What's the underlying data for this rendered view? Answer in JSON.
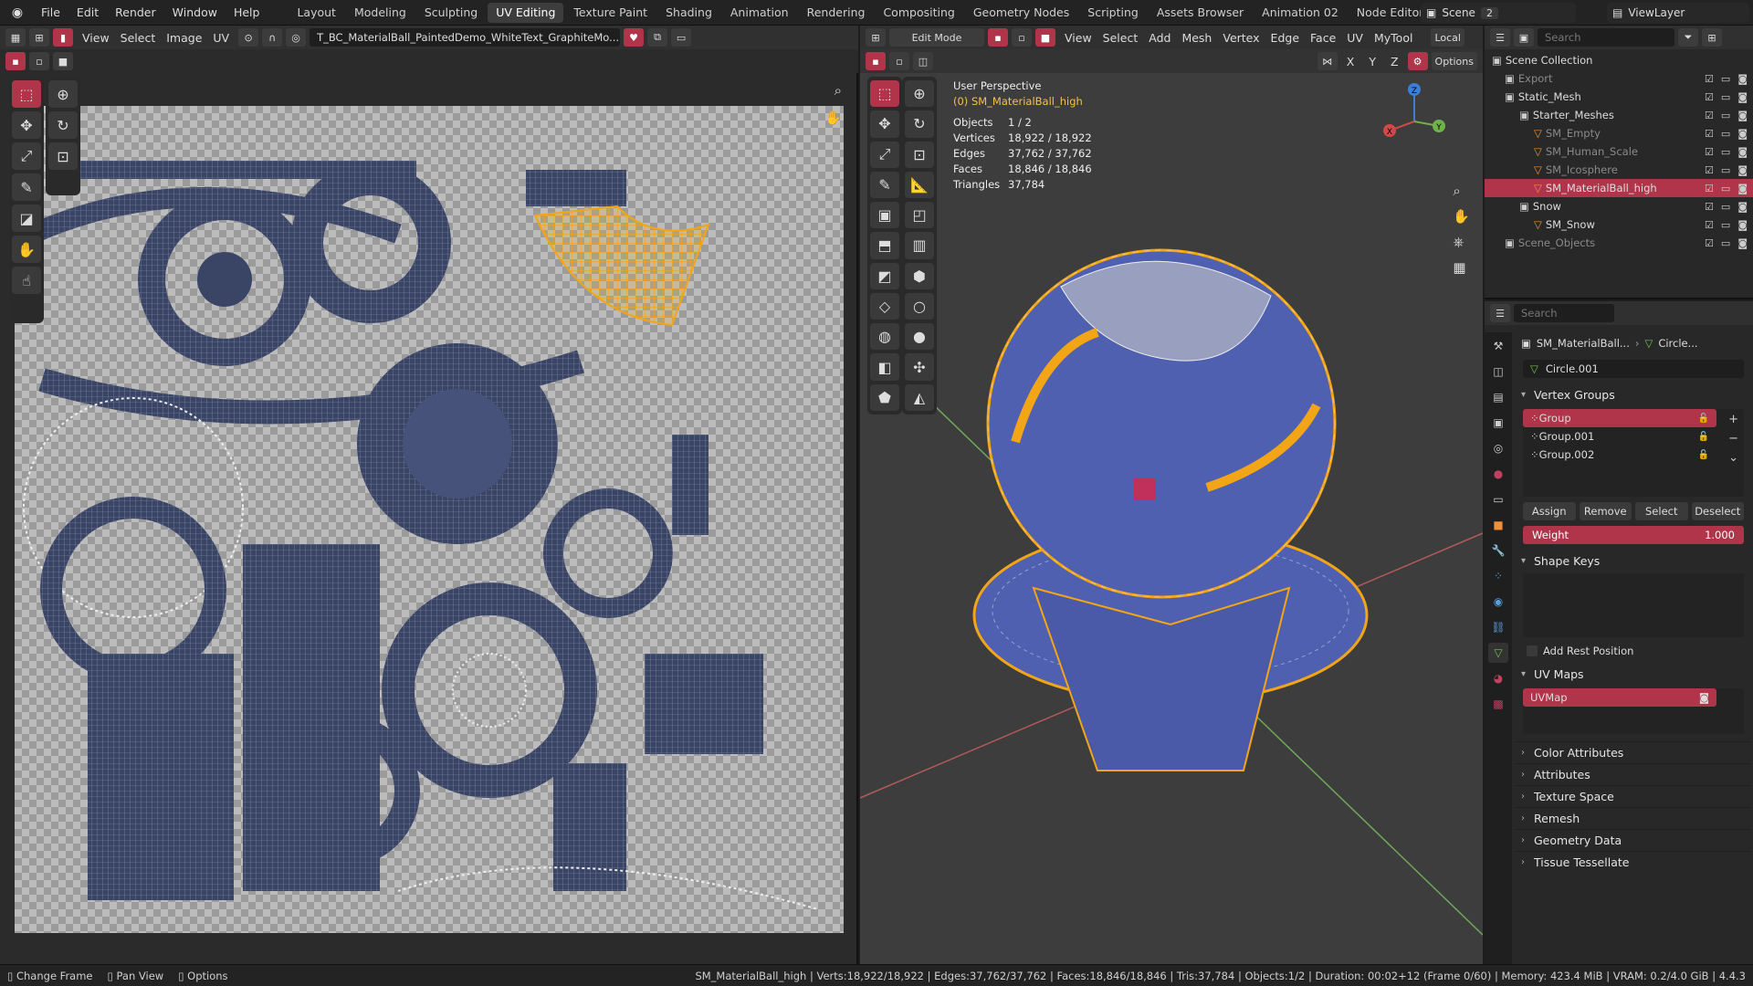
{
  "topbar": {
    "menus": [
      "File",
      "Edit",
      "Render",
      "Window",
      "Help"
    ],
    "workspaces": [
      "Layout",
      "Modeling",
      "Sculpting",
      "UV Editing",
      "Texture Paint",
      "Shading",
      "Animation",
      "Rendering",
      "Compositing",
      "Geometry Nodes",
      "Scripting",
      "Assets Browser",
      "Animation 02",
      "Node Editors"
    ],
    "active_workspace": "UV Editing",
    "add_tab": "+",
    "scene_label": "Scene",
    "scene_users": "2",
    "view_layer": "ViewLayer"
  },
  "uv_editor": {
    "menus": [
      "View",
      "Select",
      "Image",
      "UV"
    ],
    "image_name": "T_BC_MaterialBall_PaintedDemo_WhiteText_GraphiteMo..."
  },
  "viewport": {
    "mode": "Edit Mode",
    "menus": [
      "View",
      "Select",
      "Add",
      "Mesh",
      "Vertex",
      "Edge",
      "Face",
      "UV",
      "MyTool"
    ],
    "orientation": "Local",
    "axes": [
      "X",
      "Y",
      "Z"
    ],
    "options": "Options",
    "perspective": "User Perspective",
    "object_line": "(0) SM_MaterialBall_high",
    "stats": [
      {
        "k": "Objects",
        "v": "1 / 2"
      },
      {
        "k": "Vertices",
        "v": "18,922 / 18,922"
      },
      {
        "k": "Edges",
        "v": "37,762 / 37,762"
      },
      {
        "k": "Faces",
        "v": "18,846 / 18,846"
      },
      {
        "k": "Triangles",
        "v": "37,784"
      }
    ],
    "gizmo_axes": [
      "X",
      "Y",
      "Z"
    ]
  },
  "outliner": {
    "search_placeholder": "Search",
    "rows": [
      {
        "label": "Scene Collection",
        "indent": 8
      },
      {
        "label": "Export",
        "indent": 22,
        "dim": true
      },
      {
        "label": "Static_Mesh",
        "indent": 22
      },
      {
        "label": "Starter_Meshes",
        "indent": 38
      },
      {
        "label": "SM_Empty",
        "indent": 54,
        "dim": true
      },
      {
        "label": "SM_Human_Scale",
        "indent": 54,
        "dim": true
      },
      {
        "label": "SM_Icosphere",
        "indent": 54,
        "dim": true
      },
      {
        "label": "SM_MaterialBall_high",
        "indent": 54,
        "hl": true
      },
      {
        "label": "Snow",
        "indent": 38
      },
      {
        "label": "SM_Snow",
        "indent": 54
      },
      {
        "label": "Scene_Objects",
        "indent": 22,
        "dim": true
      }
    ]
  },
  "properties": {
    "search_placeholder": "Search",
    "breadcrumb_obj": "SM_MaterialBall...",
    "breadcrumb_data": "Circle...",
    "mesh_name": "Circle.001",
    "vertex_groups_title": "Vertex Groups",
    "vertex_groups": [
      "Group",
      "Group.001",
      "Group.002"
    ],
    "vg_buttons": [
      "Assign",
      "Remove",
      "Select",
      "Deselect"
    ],
    "weight_label": "Weight",
    "weight_value": "1.000",
    "shape_keys_title": "Shape Keys",
    "add_rest_position": "Add Rest Position",
    "uv_maps_title": "UV Maps",
    "uv_maps": [
      "UVMap"
    ],
    "collapsed_sections": [
      "Color Attributes",
      "Attributes",
      "Texture Space",
      "Remesh",
      "Geometry Data",
      "Tissue Tessellate"
    ]
  },
  "status": {
    "hints": [
      "Change Frame",
      "Pan View",
      "Options"
    ],
    "info": "SM_MaterialBall_high | Verts:18,922/18,922 | Edges:37,762/37,762 | Faces:18,846/18,846 | Tris:37,784 | Objects:1/2 | Duration: 00:02+12 (Frame 0/60) | Memory: 423.4 MiB | VRAM: 0.2/4.0 GiB | 4.4.3"
  },
  "colors": {
    "accent": "#b0344a",
    "uv_island": "#3a4566",
    "mesh_face": "#5060b0",
    "selection": "#f2a516"
  }
}
